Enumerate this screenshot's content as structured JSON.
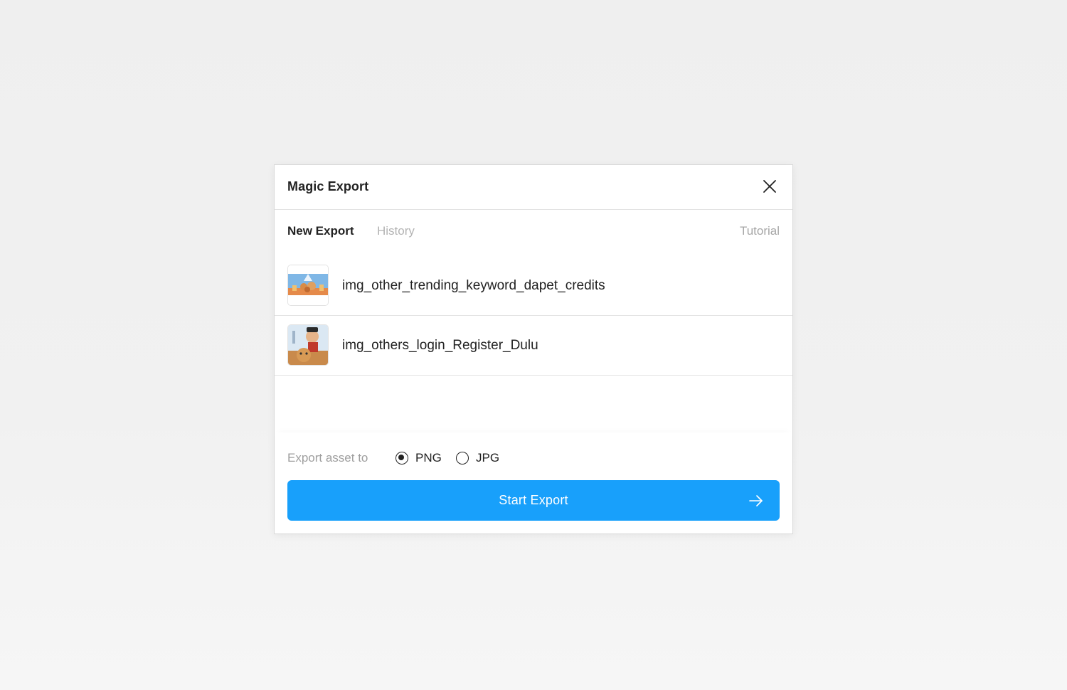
{
  "dialog": {
    "title": "Magic Export",
    "close_icon": "close-icon"
  },
  "tabs": {
    "new_export": "New Export",
    "history": "History",
    "tutorial": "Tutorial"
  },
  "assets": [
    {
      "name": "img_other_trending_keyword_dapet_credits",
      "thumbnail": "trending-thumbnail"
    },
    {
      "name": "img_others_login_Register_Dulu",
      "thumbnail": "login-thumbnail"
    }
  ],
  "export": {
    "label": "Export asset to",
    "formats": [
      "PNG",
      "JPG"
    ],
    "selected": "PNG",
    "button_label": "Start Export",
    "button_icon": "arrow-right-icon"
  },
  "colors": {
    "accent": "#18a0fb",
    "text": "#222222",
    "muted": "#9e9e9e"
  }
}
